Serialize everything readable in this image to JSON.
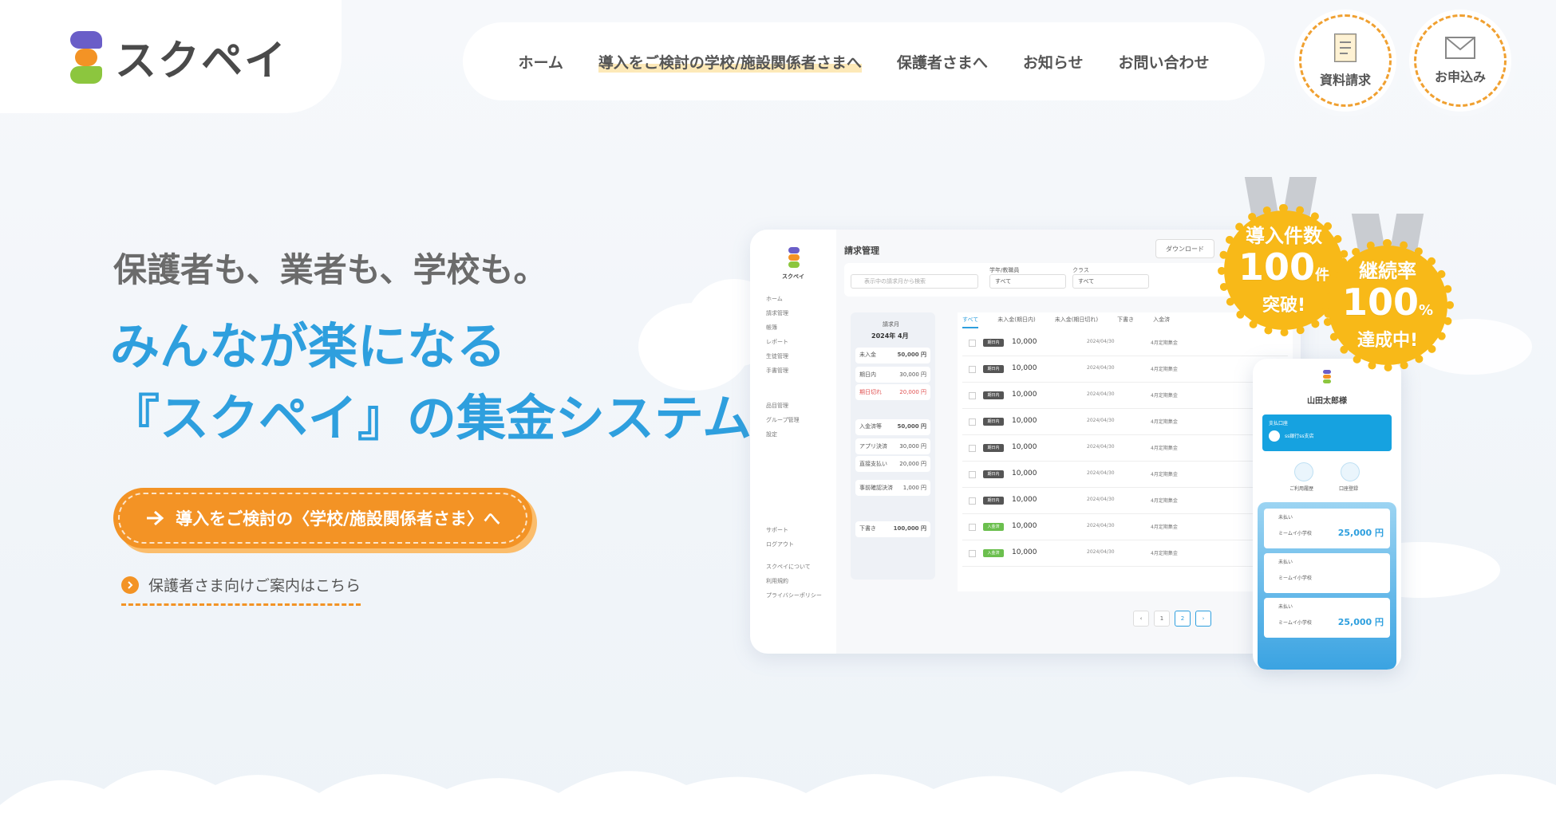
{
  "brand": {
    "name": "スクペイ",
    "colors": {
      "orange": "#f39325",
      "blue": "#2e9fde",
      "yellow": "#f8b918"
    }
  },
  "nav": {
    "items": [
      {
        "label": "ホーム"
      },
      {
        "label": "導入をご検討の学校/施設関係者さまへ"
      },
      {
        "label": "保護者さまへ"
      },
      {
        "label": "お知らせ"
      },
      {
        "label": "お問い合わせ"
      }
    ],
    "docs_button": {
      "label": "資料請求",
      "icon": "document-icon"
    },
    "apply_button": {
      "label": "お申込み",
      "icon": "mail-icon"
    }
  },
  "hero": {
    "subtitle": "保護者も、業者も、学校も。",
    "title_line1": "みんなが楽になる",
    "title_line2": "『スクペイ』の集金システム。",
    "cta_label": "導入をご検討の〈学校/施設関係者さま〉へ",
    "parent_link": "保護者さま向けご案内はこちら"
  },
  "medals": {
    "installs": {
      "line1": "導入件数",
      "number": "100",
      "unit": "件",
      "line3": "突破!"
    },
    "retention": {
      "line1": "継続率",
      "number": "100",
      "unit": "%",
      "line3": "達成中!"
    }
  },
  "dashboard": {
    "logo_text": "スクペイ",
    "title": "請求管理",
    "download_label": "ダウンロード",
    "search_placeholder": "表示中の請求月から検索",
    "filters": [
      {
        "label": "学年/教職員",
        "value": "すべて"
      },
      {
        "label": "クラス",
        "value": "すべて"
      }
    ],
    "sidebar": [
      "ホーム",
      "請求管理",
      "帳簿",
      "レポート",
      "生徒管理",
      "手書管理",
      "品目管理",
      "グループ管理",
      "設定",
      "サポート",
      "ログアウト",
      "スクペイについて",
      "利用規約",
      "プライバシーポリシー"
    ],
    "month_panel": {
      "label": "請求月",
      "month": "2024年 4月",
      "cards": [
        {
          "title": "未入金",
          "value": "50,000 円"
        },
        {
          "title": "期日内",
          "value": "30,000 円"
        },
        {
          "title": "期日切れ",
          "value": "20,000 円"
        },
        {
          "title": "入金済等",
          "value": "50,000 円"
        },
        {
          "title": "アプリ決済",
          "value": "30,000 円"
        },
        {
          "title": "直接支払い",
          "value": "20,000 円"
        },
        {
          "title": "事前確認決済",
          "value": "1,000 円"
        },
        {
          "title": "下書き",
          "value": "100,000 円"
        }
      ]
    },
    "tabs": [
      "すべて",
      "未入金(期日内)",
      "未入金(期日切れ)",
      "下書き",
      "入金済"
    ],
    "rows": [
      {
        "badge": "期日内",
        "amount": "10,000",
        "date": "2024/04/30",
        "item": "4月定期集金"
      },
      {
        "badge": "期日内",
        "amount": "10,000",
        "date": "2024/04/30",
        "item": "4月定期集金"
      },
      {
        "badge": "期日内",
        "amount": "10,000",
        "date": "2024/04/30",
        "item": "4月定期集金"
      },
      {
        "badge": "期日内",
        "amount": "10,000",
        "date": "2024/04/30",
        "item": "4月定期集金"
      },
      {
        "badge": "期日内",
        "amount": "10,000",
        "date": "2024/04/30",
        "item": "4月定期集金"
      },
      {
        "badge": "期日内",
        "amount": "10,000",
        "date": "2024/04/30",
        "item": "4月定期集金"
      },
      {
        "badge": "期日内",
        "amount": "10,000",
        "date": "2024/04/30",
        "item": "4月定期集金"
      },
      {
        "badge": "入金済",
        "amount": "10,000",
        "date": "2024/04/30",
        "item": "4月定期集金"
      },
      {
        "badge": "入金済",
        "amount": "10,000",
        "date": "2024/04/30",
        "item": "4月定期集金"
      }
    ],
    "pages": [
      "‹",
      "1",
      "2",
      "›"
    ]
  },
  "phone": {
    "user": "山田太郎様",
    "bank_label": "支払口座",
    "bank_name": "ss銀行ss支店",
    "history_label": "ご利用履歴",
    "account_label": "口座登録",
    "cards": [
      {
        "status": "未払い",
        "school": "ミームイ小学校",
        "amount": "25,000 円"
      },
      {
        "status": "未払い",
        "school": "ミームイ小学校",
        "amount": ""
      },
      {
        "status": "未払い",
        "school": "ミームイ小学校",
        "amount": "25,000 円"
      }
    ]
  }
}
